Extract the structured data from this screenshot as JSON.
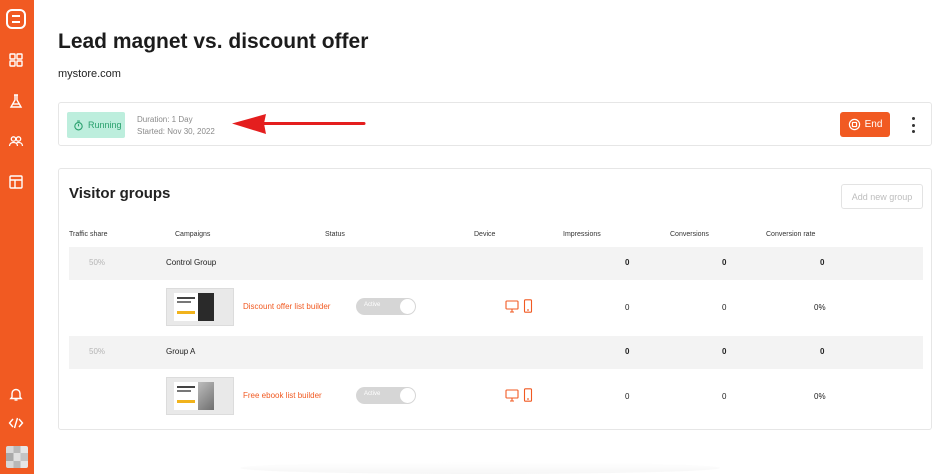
{
  "page": {
    "title": "Lead magnet vs. discount offer",
    "subtitle": "mystore.com"
  },
  "status": {
    "badge": "Running",
    "duration": "Duration: 1 Day",
    "started": "Started: Nov 30, 2022",
    "end_label": "End"
  },
  "groups": {
    "title": "Visitor groups",
    "add_label": "Add new group",
    "columns": [
      "Traffic share",
      "Campaigns",
      "Status",
      "Device",
      "Impressions",
      "Conversions",
      "Conversion rate"
    ],
    "rows": [
      {
        "share": "50%",
        "name": "Control Group",
        "impressions": "0",
        "conversions": "0",
        "rate": "0",
        "campaign": {
          "name": "Discount offer list builder",
          "status": "Active",
          "impressions": "0",
          "conversions": "0",
          "rate": "0%"
        }
      },
      {
        "share": "50%",
        "name": "Group A",
        "impressions": "0",
        "conversions": "0",
        "rate": "0",
        "campaign": {
          "name": "Free ebook list builder",
          "status": "Active",
          "impressions": "0",
          "conversions": "0",
          "rate": "0%"
        }
      }
    ]
  },
  "colors": {
    "accent": "#f15a22",
    "running_bg": "#bdeedd",
    "running_text": "#29a06d",
    "annotation_arrow": "#e41e1e"
  },
  "icons": {
    "sidebar": [
      "logo-icon",
      "dashboard-icon",
      "flask-icon",
      "users-icon",
      "layout-icon",
      "bell-icon",
      "code-icon"
    ],
    "devices": [
      "desktop-icon",
      "mobile-icon"
    ]
  }
}
